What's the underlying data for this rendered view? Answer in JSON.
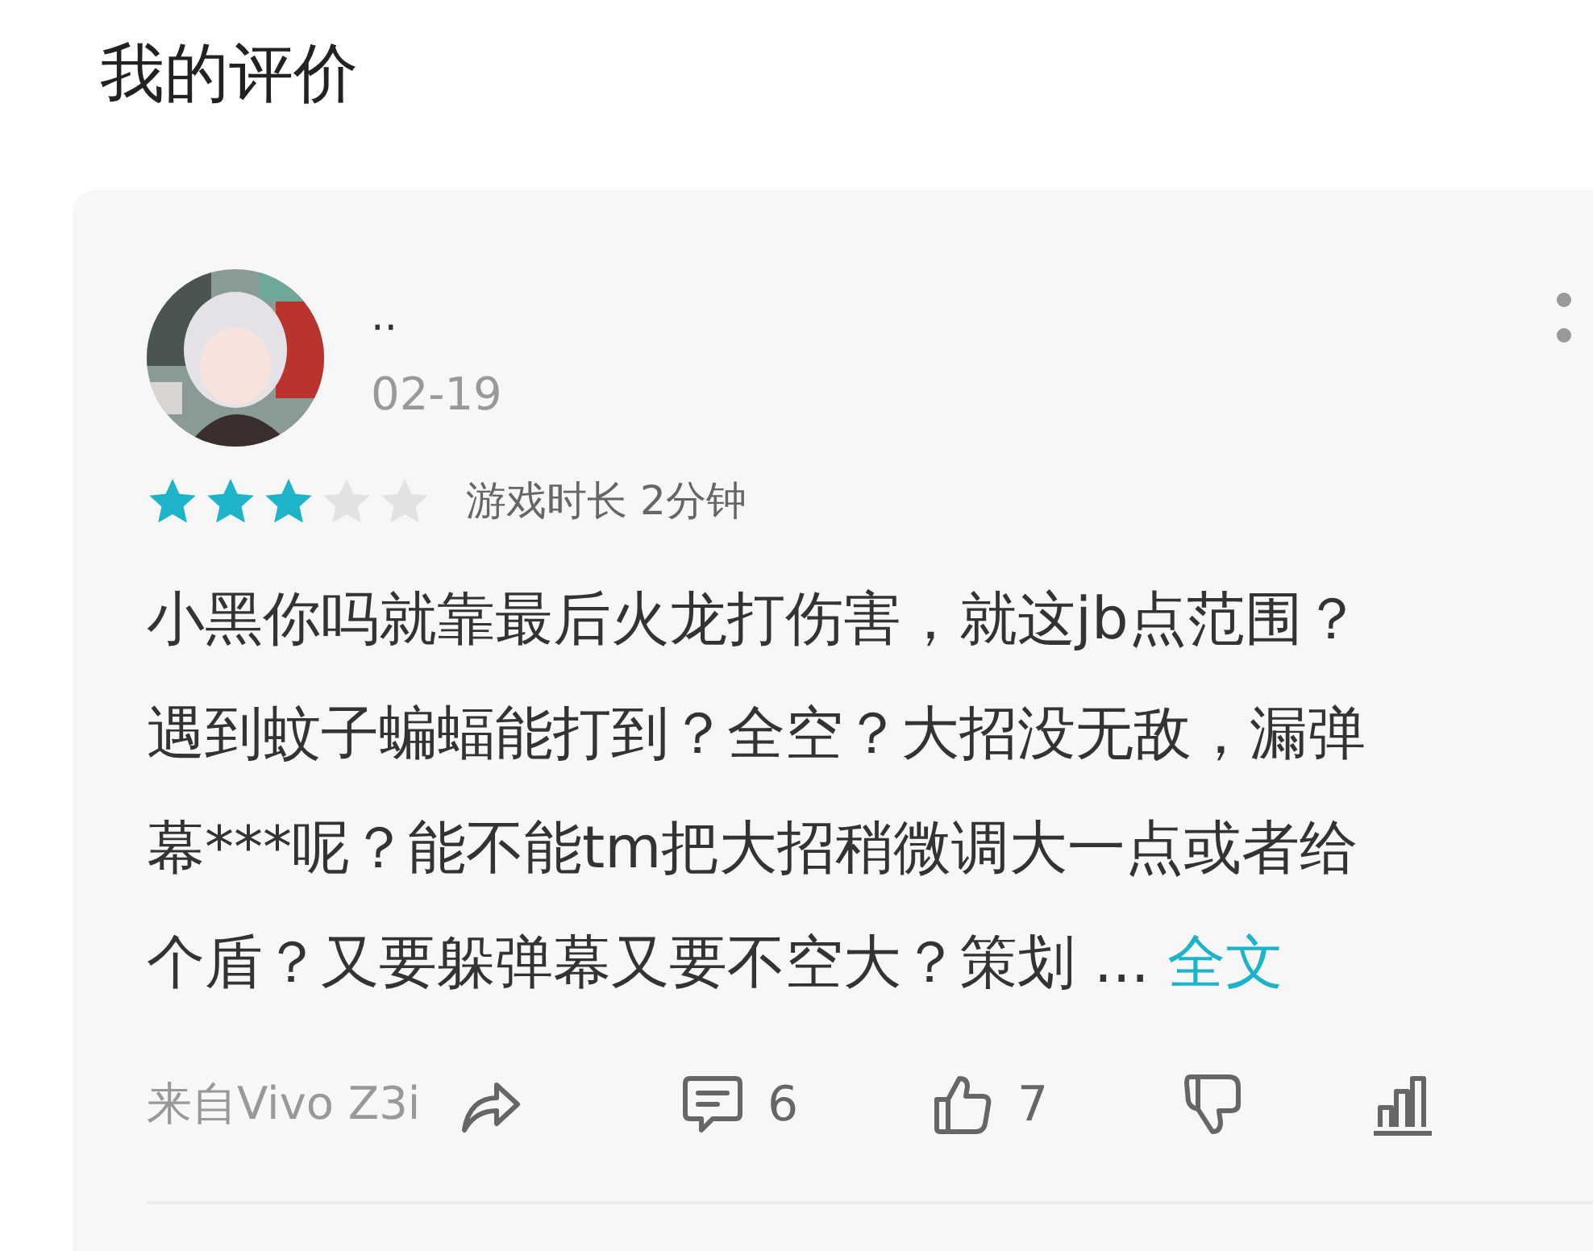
{
  "page_title": "我的评价",
  "review": {
    "user": {
      "name": "··",
      "date": "02-19"
    },
    "stars": 3,
    "playtime": "游戏时长 2分钟",
    "text_lines": [
      "小黑你吗就靠最后火龙打伤害，就这jb点范围？",
      "遇到蚊子蝙蝠能打到？全空？大招没无敌，漏弹",
      "幕***呢？能不能tm把大招稍微调大一点或者给",
      "个盾？又要躲弹幕又要不空大？策划"
    ],
    "ellipsis": "...",
    "expand_link": "全文",
    "source": "来自Vivo Z3i",
    "actions": [
      {
        "kind": "share"
      },
      {
        "kind": "comment",
        "count": "6"
      },
      {
        "kind": "like",
        "count": "7"
      },
      {
        "kind": "dislike"
      },
      {
        "kind": "stats"
      }
    ]
  }
}
